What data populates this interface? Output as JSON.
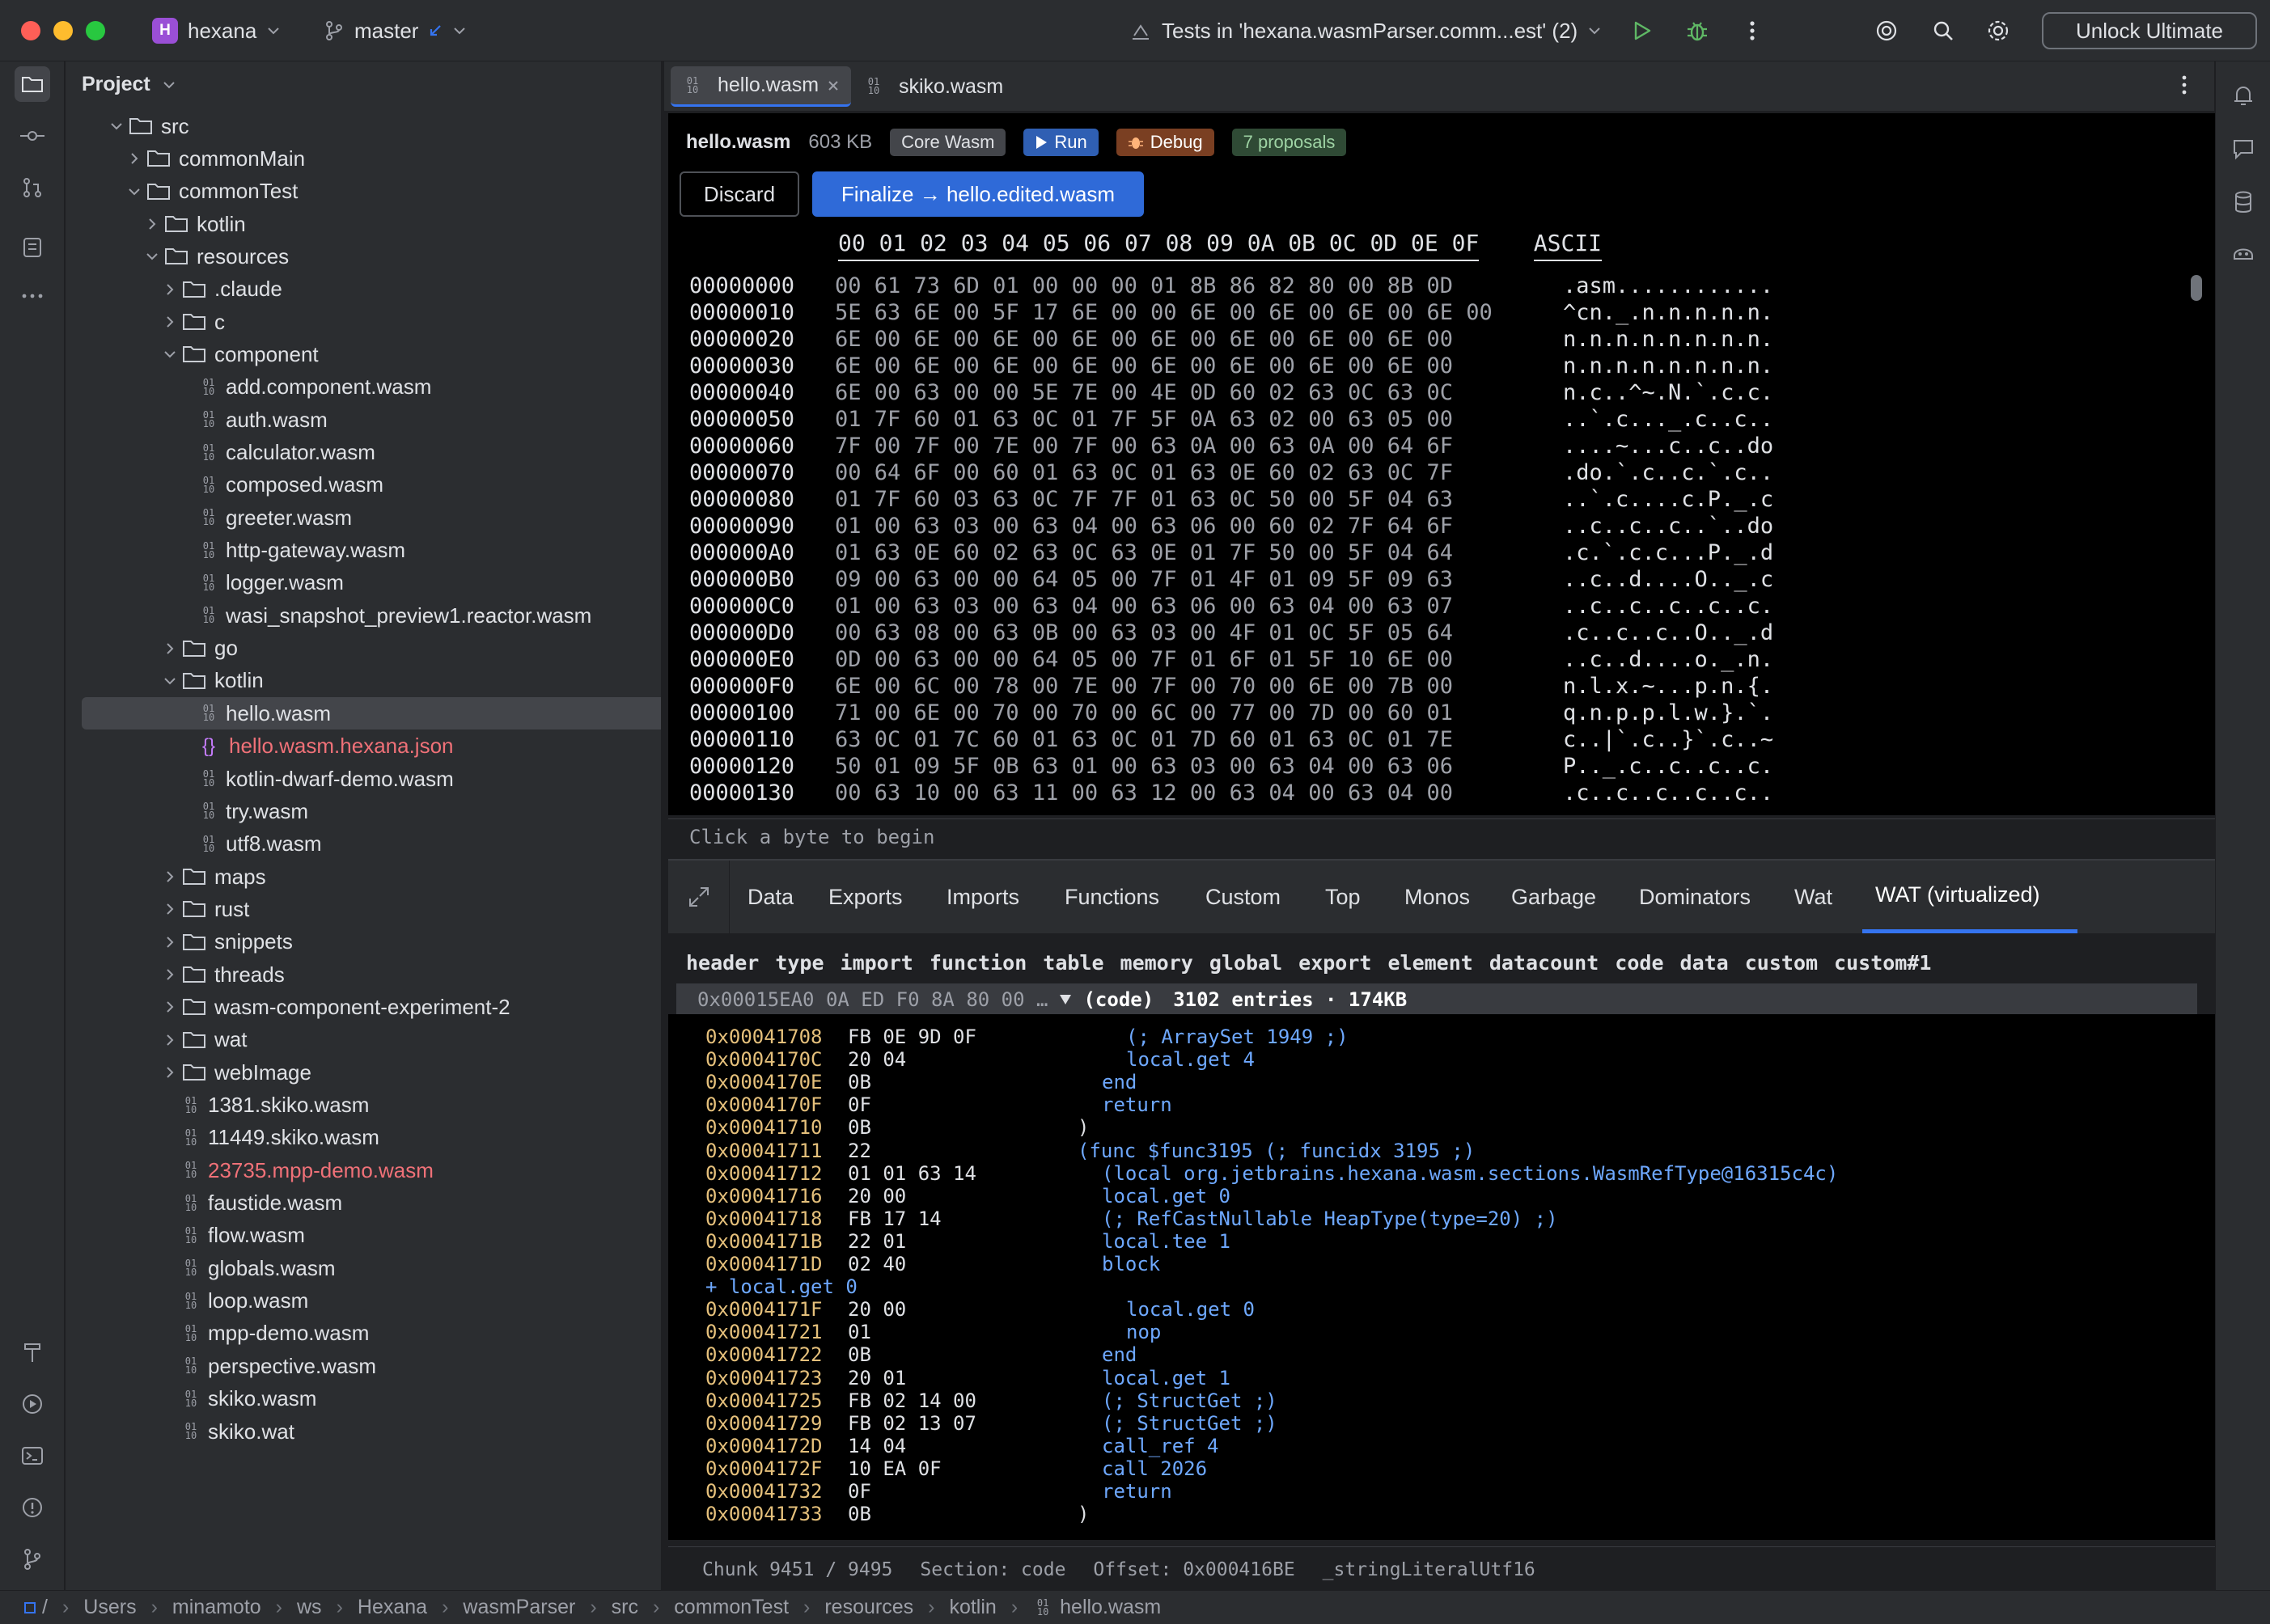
{
  "titlebar": {
    "project_badge": "H",
    "project_name": "hexana",
    "branch": "master",
    "run_config": "Tests in 'hexana.wasmParser.comm...est' (2)",
    "unlock_label": "Unlock Ultimate"
  },
  "project_panel": {
    "title": "Project",
    "tree": [
      {
        "label": "src",
        "depth": 2,
        "kind": "folder",
        "expanded": true
      },
      {
        "label": "commonMain",
        "depth": 3,
        "kind": "folder",
        "expanded": false
      },
      {
        "label": "commonTest",
        "depth": 3,
        "kind": "folder",
        "expanded": true
      },
      {
        "label": "kotlin",
        "depth": 4,
        "kind": "folder",
        "expanded": false
      },
      {
        "label": "resources",
        "depth": 4,
        "kind": "folder",
        "expanded": true
      },
      {
        "label": ".claude",
        "depth": 5,
        "kind": "folder",
        "expanded": false
      },
      {
        "label": "c",
        "depth": 5,
        "kind": "folder",
        "expanded": false
      },
      {
        "label": "component",
        "depth": 5,
        "kind": "folder",
        "expanded": true
      },
      {
        "label": "add.component.wasm",
        "depth": 6,
        "kind": "wasm"
      },
      {
        "label": "auth.wasm",
        "depth": 6,
        "kind": "wasm"
      },
      {
        "label": "calculator.wasm",
        "depth": 6,
        "kind": "wasm"
      },
      {
        "label": "composed.wasm",
        "depth": 6,
        "kind": "wasm"
      },
      {
        "label": "greeter.wasm",
        "depth": 6,
        "kind": "wasm"
      },
      {
        "label": "http-gateway.wasm",
        "depth": 6,
        "kind": "wasm"
      },
      {
        "label": "logger.wasm",
        "depth": 6,
        "kind": "wasm"
      },
      {
        "label": "wasi_snapshot_preview1.reactor.wasm",
        "depth": 6,
        "kind": "wasm"
      },
      {
        "label": "go",
        "depth": 5,
        "kind": "folder",
        "expanded": false
      },
      {
        "label": "kotlin",
        "depth": 5,
        "kind": "folder",
        "expanded": true
      },
      {
        "label": "hello.wasm",
        "depth": 6,
        "kind": "wasm",
        "selected": true
      },
      {
        "label": "hello.wasm.hexana.json",
        "depth": 6,
        "kind": "json",
        "color": "#f07178"
      },
      {
        "label": "kotlin-dwarf-demo.wasm",
        "depth": 6,
        "kind": "wasm"
      },
      {
        "label": "try.wasm",
        "depth": 6,
        "kind": "wasm"
      },
      {
        "label": "utf8.wasm",
        "depth": 6,
        "kind": "wasm"
      },
      {
        "label": "maps",
        "depth": 5,
        "kind": "folder",
        "expanded": false
      },
      {
        "label": "rust",
        "depth": 5,
        "kind": "folder",
        "expanded": false
      },
      {
        "label": "snippets",
        "depth": 5,
        "kind": "folder",
        "expanded": false
      },
      {
        "label": "threads",
        "depth": 5,
        "kind": "folder",
        "expanded": false
      },
      {
        "label": "wasm-component-experiment-2",
        "depth": 5,
        "kind": "folder",
        "expanded": false
      },
      {
        "label": "wat",
        "depth": 5,
        "kind": "folder",
        "expanded": false
      },
      {
        "label": "webImage",
        "depth": 5,
        "kind": "folder",
        "expanded": false
      },
      {
        "label": "1381.skiko.wasm",
        "depth": 5,
        "kind": "wasm"
      },
      {
        "label": "11449.skiko.wasm",
        "depth": 5,
        "kind": "wasm"
      },
      {
        "label": "23735.mpp-demo.wasm",
        "depth": 5,
        "kind": "wasm",
        "color": "#f07178"
      },
      {
        "label": "faustide.wasm",
        "depth": 5,
        "kind": "wasm"
      },
      {
        "label": "flow.wasm",
        "depth": 5,
        "kind": "wasm"
      },
      {
        "label": "globals.wasm",
        "depth": 5,
        "kind": "wasm"
      },
      {
        "label": "loop.wasm",
        "depth": 5,
        "kind": "wasm"
      },
      {
        "label": "mpp-demo.wasm",
        "depth": 5,
        "kind": "wasm"
      },
      {
        "label": "perspective.wasm",
        "depth": 5,
        "kind": "wasm"
      },
      {
        "label": "skiko.wasm",
        "depth": 5,
        "kind": "wasm"
      },
      {
        "label": "skiko.wat",
        "depth": 5,
        "kind": "wasm"
      }
    ]
  },
  "editor": {
    "tabs": [
      {
        "label": "hello.wasm",
        "active": true
      },
      {
        "label": "skiko.wasm",
        "active": false
      }
    ],
    "file": {
      "name": "hello.wasm",
      "size": "603 KB",
      "kind_chip": "Core Wasm",
      "run_label": "Run",
      "debug_label": "Debug",
      "proposals_label": "7 proposals"
    },
    "discard_label": "Discard",
    "finalize_label": "Finalize → hello.edited.wasm",
    "hex_header_cols": "00 01 02 03 04 05 06 07 08 09 0A 0B 0C 0D 0E 0F",
    "hex_header_ascii": "ASCII",
    "hex_rows": [
      {
        "off": "00000000",
        "bytes": "00 61 73 6D 01 00 00 00 01 8B 86 82 80 00 8B 0D",
        "ascii": ".asm............"
      },
      {
        "off": "00000010",
        "bytes": "5E 63 6E 00 5F 17 6E 00 00 6E 00 6E 00 6E 00 6E 00",
        "ascii": "^cn._.n.n.n.n.n."
      },
      {
        "off": "00000020",
        "bytes": "6E 00 6E 00 6E 00 6E 00 6E 00 6E 00 6E 00 6E 00",
        "ascii": "n.n.n.n.n.n.n.n."
      },
      {
        "off": "00000030",
        "bytes": "6E 00 6E 00 6E 00 6E 00 6E 00 6E 00 6E 00 6E 00",
        "ascii": "n.n.n.n.n.n.n.n."
      },
      {
        "off": "00000040",
        "bytes": "6E 00 63 00 00 5E 7E 00 4E 0D 60 02 63 0C 63 0C",
        "ascii": "n.c..^~.N.`.c.c."
      },
      {
        "off": "00000050",
        "bytes": "01 7F 60 01 63 0C 01 7F 5F 0A 63 02 00 63 05 00",
        "ascii": "..`.c..._.c..c.."
      },
      {
        "off": "00000060",
        "bytes": "7F 00 7F 00 7E 00 7F 00 63 0A 00 63 0A 00 64 6F",
        "ascii": "....~...c..c..do"
      },
      {
        "off": "00000070",
        "bytes": "00 64 6F 00 60 01 63 0C 01 63 0E 60 02 63 0C 7F",
        "ascii": ".do.`.c..c.`.c.."
      },
      {
        "off": "00000080",
        "bytes": "01 7F 60 03 63 0C 7F 7F 01 63 0C 50 00 5F 04 63",
        "ascii": "..`.c....c.P._.c"
      },
      {
        "off": "00000090",
        "bytes": "01 00 63 03 00 63 04 00 63 06 00 60 02 7F 64 6F",
        "ascii": "..c..c..c..`..do"
      },
      {
        "off": "000000A0",
        "bytes": "01 63 0E 60 02 63 0C 63 0E 01 7F 50 00 5F 04 64",
        "ascii": ".c.`.c.c...P._.d"
      },
      {
        "off": "000000B0",
        "bytes": "09 00 63 00 00 64 05 00 7F 01 4F 01 09 5F 09 63",
        "ascii": "..c..d....O.._.c"
      },
      {
        "off": "000000C0",
        "bytes": "01 00 63 03 00 63 04 00 63 06 00 63 04 00 63 07",
        "ascii": "..c..c..c..c..c."
      },
      {
        "off": "000000D0",
        "bytes": "00 63 08 00 63 0B 00 63 03 00 4F 01 0C 5F 05 64",
        "ascii": ".c..c..c..O.._.d"
      },
      {
        "off": "000000E0",
        "bytes": "0D 00 63 00 00 64 05 00 7F 01 6F 01 5F 10 6E 00",
        "ascii": "..c..d....o._.n."
      },
      {
        "off": "000000F0",
        "bytes": "6E 00 6C 00 78 00 7E 00 7F 00 70 00 6E 00 7B 00",
        "ascii": "n.l.x.~...p.n.{."
      },
      {
        "off": "00000100",
        "bytes": "71 00 6E 00 70 00 70 00 6C 00 77 00 7D 00 60 01",
        "ascii": "q.n.p.p.l.w.}.`."
      },
      {
        "off": "00000110",
        "bytes": "63 0C 01 7C 60 01 63 0C 01 7D 60 01 63 0C 01 7E",
        "ascii": "c..|`.c..}`.c..~"
      },
      {
        "off": "00000120",
        "bytes": "50 01 09 5F 0B 63 01 00 63 03 00 63 04 00 63 06",
        "ascii": "P.._.c..c..c..c."
      },
      {
        "off": "00000130",
        "bytes": "00 63 10 00 63 11 00 63 12 00 63 04 00 63 04 00",
        "ascii": ".c..c..c..c..c.."
      }
    ],
    "hex_status": "Click a byte to begin"
  },
  "bottom_panel": {
    "tabs": [
      "Data",
      "Exports",
      "Imports",
      "Functions",
      "Custom",
      "Top",
      "Monos",
      "Garbage",
      "Dominators",
      "Wat",
      "WAT (virtualized)"
    ],
    "active_tab": "WAT (virtualized)",
    "sections": [
      "header",
      "type",
      "import",
      "function",
      "table",
      "memory",
      "global",
      "export",
      "element",
      "datacount",
      "code",
      "data",
      "custom",
      "custom#1"
    ],
    "codebar": {
      "prefix": "0x00015EA0 0A ED F0 8A 80 00 …",
      "label": "(code)",
      "summary": "3102 entries · 174KB"
    },
    "lines": [
      {
        "addr": "0x00041708",
        "bytes": "FB 0E 9D 0F",
        "text": "(; ArraySet 1949 ;)",
        "indent": 2
      },
      {
        "addr": "0x0004170C",
        "bytes": "20 04",
        "text": "local.get 4",
        "indent": 2
      },
      {
        "addr": "0x0004170E",
        "bytes": "0B",
        "text": "end",
        "indent": 1
      },
      {
        "addr": "0x0004170F",
        "bytes": "0F",
        "text": "return",
        "indent": 1
      },
      {
        "addr": "0x00041710",
        "bytes": "0B",
        "text": ")",
        "indent": 0,
        "plain": true
      },
      {
        "addr": "0x00041711",
        "bytes": "22",
        "text": "(func $func3195 (; funcidx 3195 ;)",
        "indent": 0
      },
      {
        "addr": "0x00041712",
        "bytes": "01 01 63 14",
        "text": "(local org.jetbrains.hexana.wasm.sections.WasmRefType@16315c4c)",
        "indent": 1
      },
      {
        "addr": "0x00041716",
        "bytes": "20 00",
        "text": "local.get 0",
        "indent": 1
      },
      {
        "addr": "0x00041718",
        "bytes": "FB 17 14",
        "text": "(; RefCastNullable HeapType(type=20) ;)",
        "indent": 1
      },
      {
        "addr": "0x0004171B",
        "bytes": "22 01",
        "text": "local.tee 1",
        "indent": 1
      },
      {
        "addr": "0x0004171D",
        "bytes": "02 40",
        "text": "block",
        "indent": 1
      },
      {
        "addr": "",
        "bytes": "",
        "text": "+ local.get 0",
        "indent": -1,
        "insert": true
      },
      {
        "addr": "0x0004171F",
        "bytes": "20 00",
        "text": "local.get 0",
        "indent": 2
      },
      {
        "addr": "0x00041721",
        "bytes": "01",
        "text": "nop",
        "indent": 2
      },
      {
        "addr": "0x00041722",
        "bytes": "0B",
        "text": "end",
        "indent": 1
      },
      {
        "addr": "0x00041723",
        "bytes": "20 01",
        "text": "local.get 1",
        "indent": 1
      },
      {
        "addr": "0x00041725",
        "bytes": "FB 02 14 00",
        "text": "(; StructGet ;)",
        "indent": 1
      },
      {
        "addr": "0x00041729",
        "bytes": "FB 02 13 07",
        "text": "(; StructGet ;)",
        "indent": 1
      },
      {
        "addr": "0x0004172D",
        "bytes": "14 04",
        "text": "call_ref 4",
        "indent": 1
      },
      {
        "addr": "0x0004172F",
        "bytes": "10 EA 0F",
        "text": "call 2026",
        "indent": 1
      },
      {
        "addr": "0x00041732",
        "bytes": "0F",
        "text": "return",
        "indent": 1
      },
      {
        "addr": "0x00041733",
        "bytes": "0B",
        "text": ")",
        "indent": 0,
        "plain": true
      }
    ],
    "status": {
      "chunk": "Chunk 9451 / 9495",
      "section": "Section: code",
      "offset": "Offset: 0x000416BE",
      "symbol": "_stringLiteralUtf16"
    }
  },
  "breadcrumbs": [
    "/",
    "Users",
    "minamoto",
    "ws",
    "Hexana",
    "wasmParser",
    "src",
    "commonTest",
    "resources",
    "kotlin",
    "hello.wasm"
  ],
  "colors": {
    "accent": "#3574f0",
    "finalize": "#2f6ad8",
    "run_chip": "#2f5fb3",
    "debug_chip": "#7a3f22",
    "proposals_chip": "#2f4a35",
    "error_text": "#f07178"
  }
}
